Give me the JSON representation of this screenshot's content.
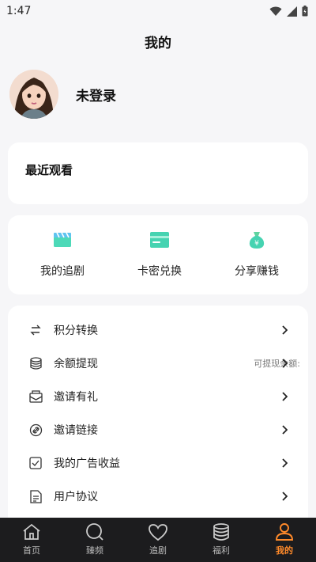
{
  "status_bar": {
    "time": "1:47"
  },
  "header": {
    "title": "我的"
  },
  "profile": {
    "name": "未登录"
  },
  "recent": {
    "title": "最近观看"
  },
  "quick_actions": [
    {
      "label": "我的追剧",
      "icon": "clapperboard-icon"
    },
    {
      "label": "卡密兑换",
      "icon": "card-icon"
    },
    {
      "label": "分享赚钱",
      "icon": "money-bag-icon"
    }
  ],
  "menu": [
    {
      "label": "积分转换",
      "icon": "convert-icon",
      "extra": ""
    },
    {
      "label": "余额提现",
      "icon": "coins-icon",
      "extra": "可提现余额:"
    },
    {
      "label": "邀请有礼",
      "icon": "gift-mail-icon",
      "extra": ""
    },
    {
      "label": "邀请链接",
      "icon": "link-icon",
      "extra": ""
    },
    {
      "label": "我的广告收益",
      "icon": "checkbox-icon",
      "extra": ""
    },
    {
      "label": "用户协议",
      "icon": "document-icon",
      "extra": ""
    }
  ],
  "bottom_nav": [
    {
      "label": "首页",
      "icon": "home-icon",
      "active": false
    },
    {
      "label": "臻频",
      "icon": "search-icon",
      "active": false
    },
    {
      "label": "追剧",
      "icon": "heart-icon",
      "active": false
    },
    {
      "label": "福利",
      "icon": "database-icon",
      "active": false
    },
    {
      "label": "我的",
      "icon": "user-icon",
      "active": true
    }
  ],
  "colors": {
    "accent": "#ff8a2a",
    "nav_bg": "#1c1c1e",
    "teal": "#3ed3c0"
  }
}
